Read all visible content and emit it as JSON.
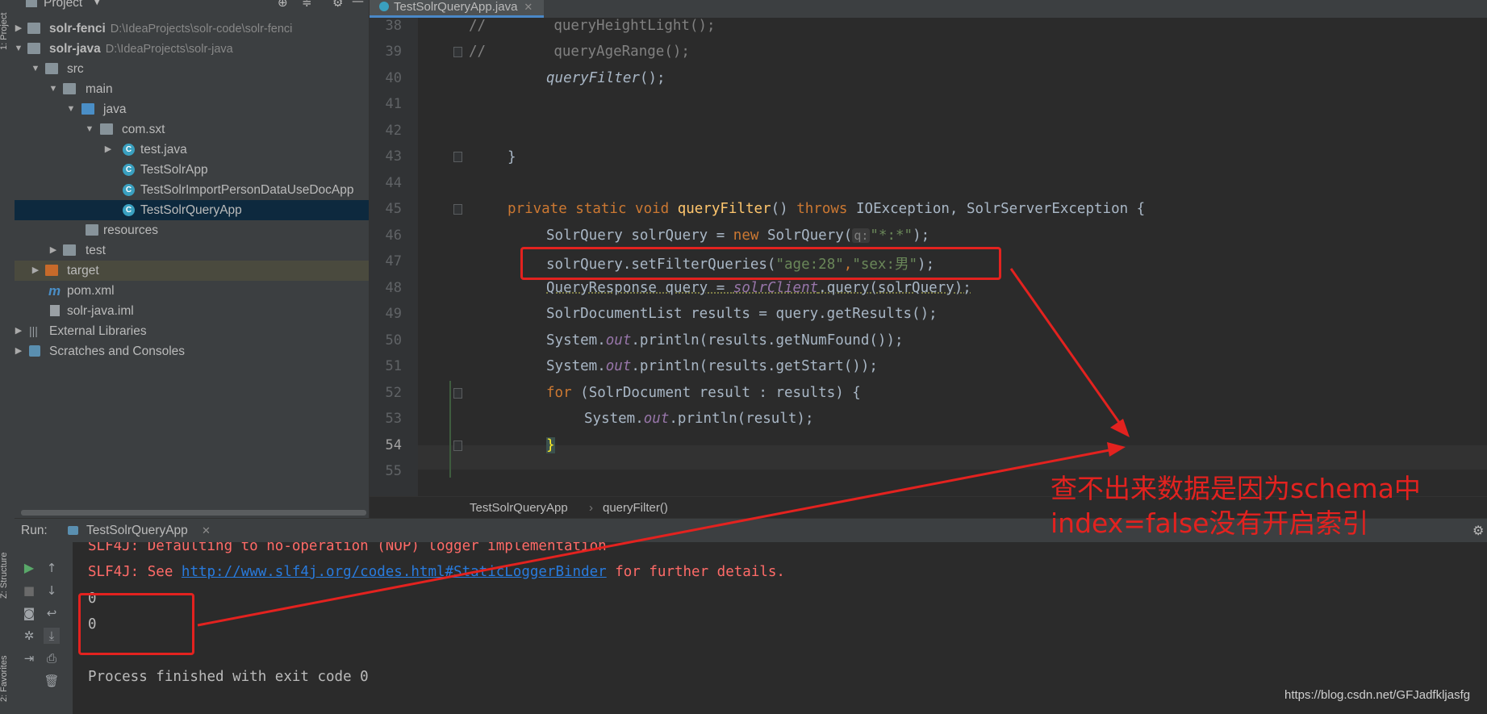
{
  "project_panel": {
    "title": "Project",
    "tree": [
      {
        "label": "solr-fenci",
        "path": "D:\\IdeaProjects\\solr-code\\solr-fenci"
      },
      {
        "label": "solr-java",
        "path": "D:\\IdeaProjects\\solr-java"
      },
      {
        "label": "src"
      },
      {
        "label": "main"
      },
      {
        "label": "java"
      },
      {
        "label": "com.sxt"
      },
      {
        "label": "test.java"
      },
      {
        "label": "TestSolrApp"
      },
      {
        "label": "TestSolrImportPersonDataUseDocApp"
      },
      {
        "label": "TestSolrQueryApp"
      },
      {
        "label": "resources"
      },
      {
        "label": "test"
      },
      {
        "label": "target"
      },
      {
        "label": "pom.xml"
      },
      {
        "label": "solr-java.iml"
      },
      {
        "label": "External Libraries"
      },
      {
        "label": "Scratches and Consoles"
      }
    ]
  },
  "side_tabs": {
    "project": "1: Project",
    "structure": "Z: Structure",
    "favorites": "2: Favorites"
  },
  "editor": {
    "tab_title": "TestSolrQueryApp.java",
    "line_numbers": [
      "38",
      "39",
      "40",
      "41",
      "42",
      "43",
      "44",
      "45",
      "46",
      "47",
      "48",
      "49",
      "50",
      "51",
      "52",
      "53",
      "54",
      "55"
    ],
    "lines": {
      "l38": "//        queryHeightLight();",
      "l39": "//        queryAgeRange();",
      "l40_call": "queryFilter",
      "l40_rest": "();",
      "l43": "}",
      "l45_kw": "private static void ",
      "l45_fn": "queryFilter",
      "l45_mid": "() ",
      "l45_throws": "throws ",
      "l45_rest": "IOException, SolrServerException {",
      "l46_a": "SolrQuery solrQuery = ",
      "l46_new": "new ",
      "l46_b": "SolrQuery(",
      "l46_hint": "q:",
      "l46_str": "\"*:*\"",
      "l46_c": ");",
      "l47_a": "solrQuery.setFilterQueries(",
      "l47_s1": "\"age:28\"",
      "l47_comma": ",",
      "l47_s2": "\"sex:男\"",
      "l47_c": ");",
      "l48_a": "QueryResponse query = ",
      "l48_fld": "solrClient",
      "l48_b": ".query(solrQuery);",
      "l49": "SolrDocumentList results = query.getResults();",
      "l50_a": "System.",
      "l50_out": "out",
      "l50_b": ".println(results.getNumFound());",
      "l51_a": "System.",
      "l51_out": "out",
      "l51_b": ".println(results.getStart());",
      "l52_for": "for ",
      "l52_b": "(SolrDocument result : results) {",
      "l53_a": "System.",
      "l53_out": "out",
      "l53_b": ".println(result);",
      "l54": "}"
    },
    "breadcrumb": [
      "TestSolrQueryApp",
      "queryFilter()"
    ]
  },
  "run_panel": {
    "label": "Run:",
    "tab": "TestSolrQueryApp",
    "console": {
      "line1": "SLF4J: Defaulting to no-operation (NOP) logger implementation",
      "line2_a": "SLF4J: See ",
      "line2_link": "http://www.slf4j.org/codes.html#StaticLoggerBinder",
      "line2_b": " for further details.",
      "out1": "0",
      "out2": "0",
      "finish": "Process finished with exit code 0"
    }
  },
  "annotation": {
    "line1": "查不出来数据是因为schema中",
    "line2": "index=false没有开启索引"
  },
  "watermark": "https://blog.csdn.net/GFJadfkljasfg",
  "colors": {
    "accent_red": "#e3221f",
    "keyword": "#cc7832",
    "function": "#ffc66d",
    "string": "#6a8759"
  }
}
